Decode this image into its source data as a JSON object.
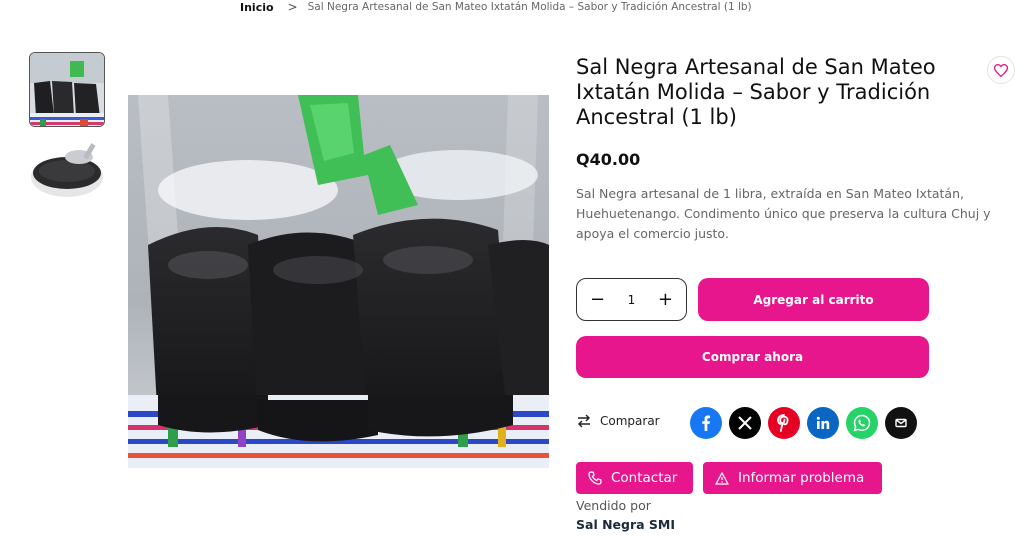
{
  "breadcrumb": {
    "home": "Inicio",
    "separator": ">",
    "current": "Sal Negra Artesanal de San Mateo Ixtatán Molida – Sabor y Tradición Ancestral (1 lb)"
  },
  "product": {
    "title": "Sal Negra Artesanal de San Mateo Ixtatán Molida – Sabor y Tradición Ancestral (1 lb)",
    "price": "Q40.00",
    "description": "Sal Negra artesanal de 1 libra, extraída en San Mateo Ixtatán, Huehuetenango. Condimento único que preserva la cultura Chuj y apoya el comercio justo.",
    "quantity": "1"
  },
  "actions": {
    "add_to_cart": "Agregar al carrito",
    "buy_now": "Comprar ahora",
    "compare": "Comparar",
    "contact": "Contactar",
    "report": "Informar problema"
  },
  "vendor": {
    "label": "Vendido por",
    "name": "Sal Negra SMI"
  },
  "share_icons": [
    "facebook-icon",
    "x-icon",
    "pinterest-icon",
    "linkedin-icon",
    "whatsapp-icon",
    "email-icon"
  ],
  "colors": {
    "accent": "#e8168c",
    "facebook": "#1877f2",
    "x": "#000000",
    "pinterest": "#e60023",
    "linkedin": "#0a66c2",
    "whatsapp": "#25d366",
    "email": "#111111"
  }
}
